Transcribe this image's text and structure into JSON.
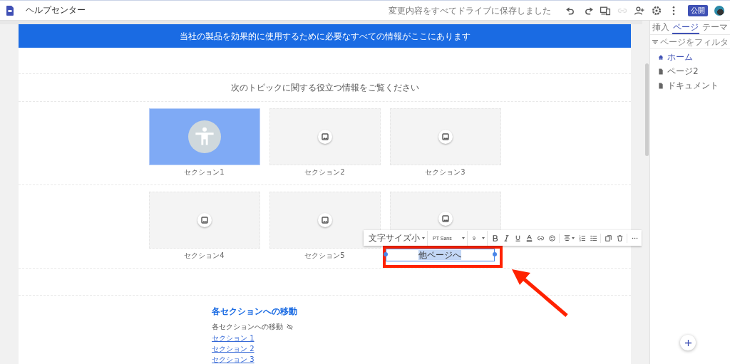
{
  "app": {
    "title": "ヘルプセンター",
    "save_status": "変更内容をすべてドライブに保存しました",
    "publish_button": "公開",
    "actions": [
      {
        "kind": "undo",
        "disabled": false
      },
      {
        "kind": "redo",
        "disabled": false
      },
      {
        "kind": "preview",
        "disabled": false
      },
      {
        "kind": "link",
        "disabled": true
      },
      {
        "kind": "share",
        "disabled": false
      },
      {
        "kind": "settings",
        "disabled": false
      },
      {
        "kind": "more",
        "disabled": false
      }
    ]
  },
  "site": {
    "banner": "当社の製品を効果的に使用するために必要なすべての情報がここにあります",
    "subtitle": "次のトピックに関する役立つ情報をご覧ください",
    "cards": [
      {
        "label": "セクション1",
        "kind": "accessibility",
        "selected": false
      },
      {
        "label": "セクション2",
        "kind": "empty",
        "selected": false
      },
      {
        "label": "セクション3",
        "kind": "empty",
        "selected": false
      },
      {
        "label": "セクション4",
        "kind": "empty",
        "selected": false
      },
      {
        "label": "セクション5",
        "kind": "empty",
        "selected": false
      },
      {
        "label": "他ページへ",
        "kind": "empty",
        "selected": true
      }
    ],
    "nav": {
      "heading": "各セクションへの移動",
      "intro": "各セクションへの移動",
      "links": [
        "セクション 1",
        "セクション 2",
        "セクション 3"
      ]
    }
  },
  "format_toolbar": {
    "text_style": "文字サイズ小",
    "font": "PT Sans",
    "size": "9"
  },
  "sidebar": {
    "tabs": [
      {
        "label": "挿入",
        "selected": false
      },
      {
        "label": "ページ",
        "selected": true
      },
      {
        "label": "テーマ",
        "selected": false
      }
    ],
    "filter": {
      "placeholder": "ページをフィルタ"
    },
    "pages": [
      {
        "label": "ホーム",
        "kind": "home",
        "selected": true
      },
      {
        "label": "ページ2",
        "kind": "page",
        "selected": false
      },
      {
        "label": "ドキュメント",
        "kind": "page",
        "selected": false
      }
    ]
  }
}
